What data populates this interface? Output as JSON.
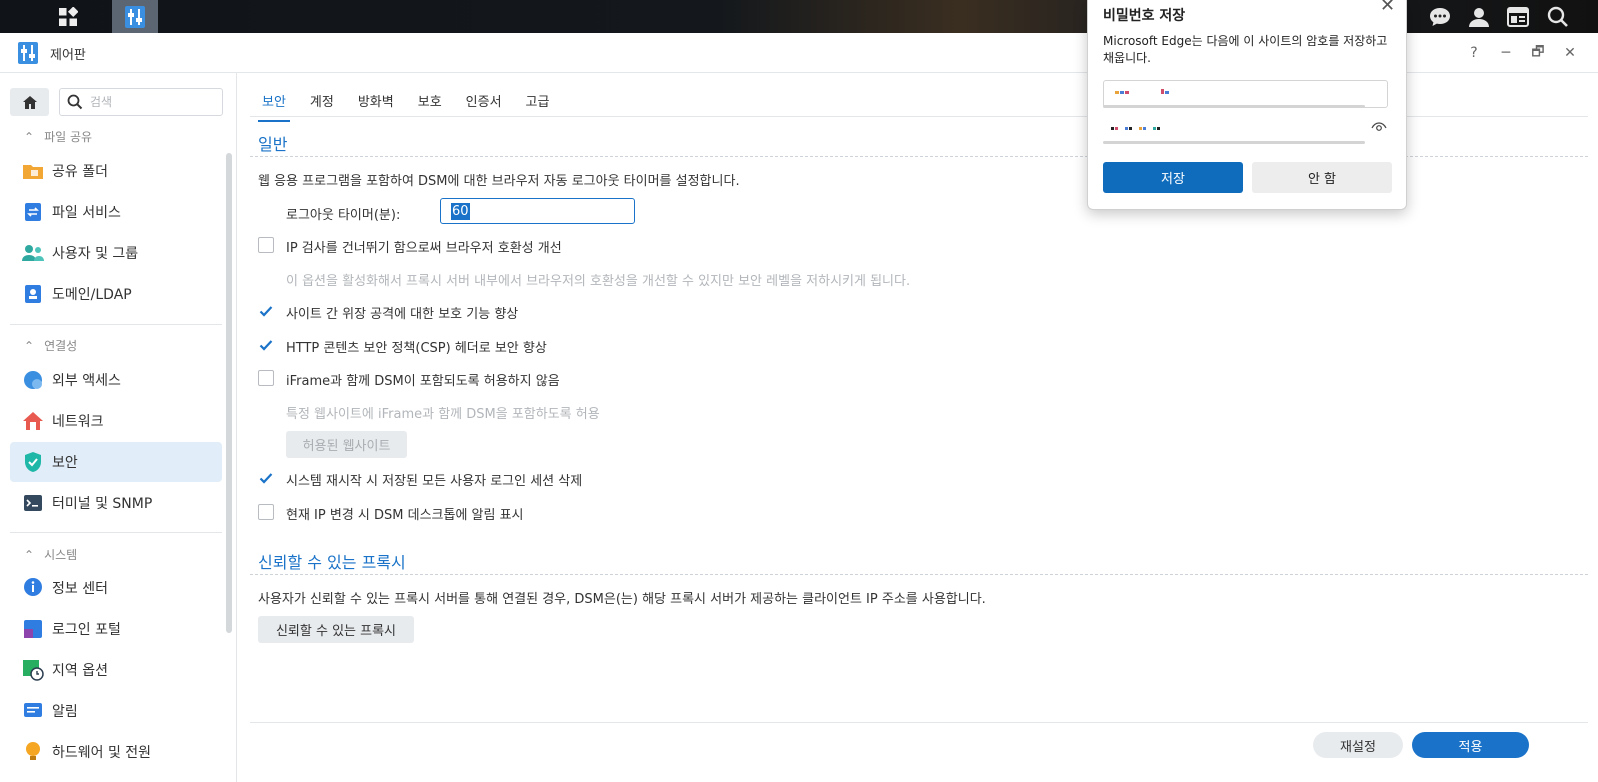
{
  "taskbar": {
    "icons": [
      "apps-grid-icon",
      "control-panel-icon",
      "chat-icon",
      "user-icon",
      "widget-icon",
      "search-icon"
    ]
  },
  "window": {
    "title": "제어판",
    "controls": [
      "?",
      "─",
      "🗗",
      "✕"
    ]
  },
  "sidebar": {
    "search_placeholder": "검색",
    "sections": [
      {
        "label": "파일 공유",
        "items": [
          "공유 폴더",
          "파일 서비스",
          "사용자 및 그룹",
          "도메인/LDAP"
        ]
      },
      {
        "label": "연결성",
        "items": [
          "외부 액세스",
          "네트워크",
          "보안",
          "터미널 및 SNMP"
        ]
      },
      {
        "label": "시스템",
        "items": [
          "정보 센터",
          "로그인 포털",
          "지역 옵션",
          "알림",
          "하드웨어 및 전원"
        ]
      }
    ],
    "active_item": "보안"
  },
  "tabs": [
    "보안",
    "계정",
    "방화벽",
    "보호",
    "인증서",
    "고급"
  ],
  "active_tab": "보안",
  "general": {
    "title": "일반",
    "desc": "웹 응용 프로그램을 포함하여 DSM에 대한 브라우저 자동 로그아웃 타이머를 설정합니다.",
    "timer_label": "로그아웃 타이머(분):",
    "timer_value": "60",
    "options": [
      {
        "label": "IP 검사를 건너뛰기 함으로써 브라우저 호환성 개선",
        "checked": false
      },
      {
        "note": "이 옵션을 활성화해서 프록시 서버 내부에서 브라우저의 호환성을 개선할 수 있지만 보안 레벨을 저하시키게 됩니다."
      },
      {
        "label": "사이트 간 위장 공격에 대한 보호 기능 향상",
        "checked": true
      },
      {
        "label": "HTTP 콘텐츠 보안 정책(CSP) 헤더로 보안 향상",
        "checked": true
      },
      {
        "label": "iFrame과 함께 DSM이 포함되도록 허용하지 않음",
        "checked": false
      },
      {
        "note": "특정 웹사이트에 iFrame과 함께 DSM을 포함하도록 허용"
      },
      {
        "label": "시스템 재시작 시 저장된 모든 사용자 로그인 세션 삭제",
        "checked": true
      },
      {
        "label": "현재 IP 변경 시 DSM 데스크톱에 알림 표시",
        "checked": false
      }
    ],
    "allowed_sites_button": "허용된 웹사이트"
  },
  "proxy": {
    "title": "신뢰할 수 있는 프록시",
    "desc": "사용자가 신뢰할 수 있는 프록시 서버를 통해 연결된 경우, DSM은(는) 해당 프록시 서버가 제공하는 클라이언트 IP 주소를 사용합니다.",
    "button": "신뢰할 수 있는 프록시"
  },
  "footer": {
    "reset": "재설정",
    "apply": "적용"
  },
  "password_popup": {
    "title": "비밀번호 저장",
    "desc": "Microsoft Edge는 다음에 이 사이트의 암호를 저장하고 채웁니다.",
    "save": "저장",
    "cancel": "안 함"
  },
  "colors": {
    "accent": "#1a73c8",
    "edge_blue": "#0f6cbd",
    "active_nav_bg": "#e1edf8"
  }
}
